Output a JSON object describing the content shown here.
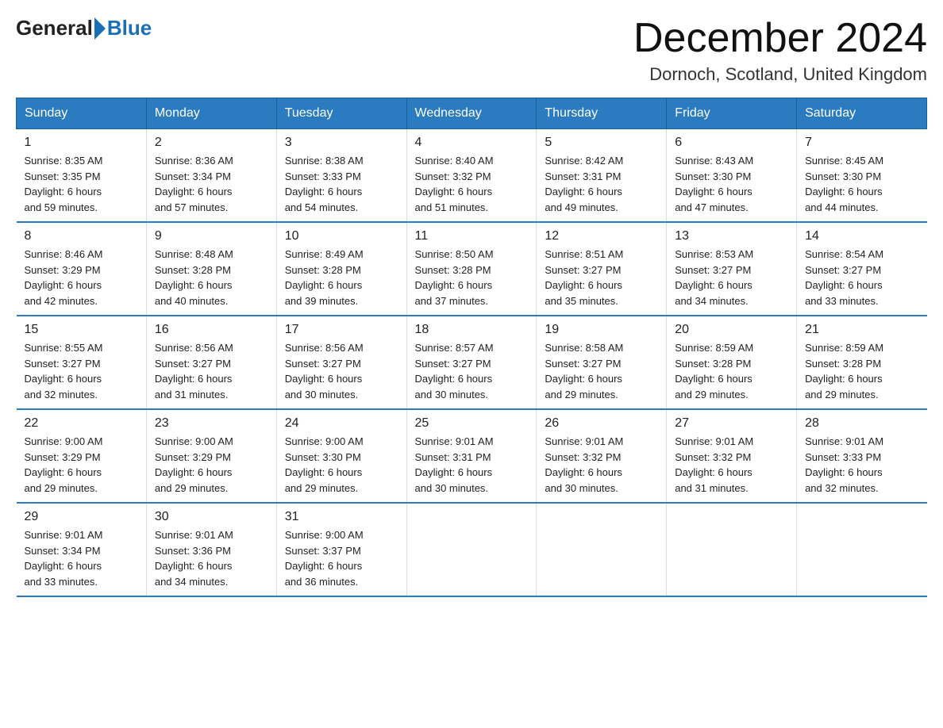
{
  "header": {
    "logo_general": "General",
    "logo_blue": "Blue",
    "title": "December 2024",
    "subtitle": "Dornoch, Scotland, United Kingdom"
  },
  "weekdays": [
    "Sunday",
    "Monday",
    "Tuesday",
    "Wednesday",
    "Thursday",
    "Friday",
    "Saturday"
  ],
  "weeks": [
    [
      {
        "day": "1",
        "sunrise": "8:35 AM",
        "sunset": "3:35 PM",
        "daylight": "6 hours and 59 minutes."
      },
      {
        "day": "2",
        "sunrise": "8:36 AM",
        "sunset": "3:34 PM",
        "daylight": "6 hours and 57 minutes."
      },
      {
        "day": "3",
        "sunrise": "8:38 AM",
        "sunset": "3:33 PM",
        "daylight": "6 hours and 54 minutes."
      },
      {
        "day": "4",
        "sunrise": "8:40 AM",
        "sunset": "3:32 PM",
        "daylight": "6 hours and 51 minutes."
      },
      {
        "day": "5",
        "sunrise": "8:42 AM",
        "sunset": "3:31 PM",
        "daylight": "6 hours and 49 minutes."
      },
      {
        "day": "6",
        "sunrise": "8:43 AM",
        "sunset": "3:30 PM",
        "daylight": "6 hours and 47 minutes."
      },
      {
        "day": "7",
        "sunrise": "8:45 AM",
        "sunset": "3:30 PM",
        "daylight": "6 hours and 44 minutes."
      }
    ],
    [
      {
        "day": "8",
        "sunrise": "8:46 AM",
        "sunset": "3:29 PM",
        "daylight": "6 hours and 42 minutes."
      },
      {
        "day": "9",
        "sunrise": "8:48 AM",
        "sunset": "3:28 PM",
        "daylight": "6 hours and 40 minutes."
      },
      {
        "day": "10",
        "sunrise": "8:49 AM",
        "sunset": "3:28 PM",
        "daylight": "6 hours and 39 minutes."
      },
      {
        "day": "11",
        "sunrise": "8:50 AM",
        "sunset": "3:28 PM",
        "daylight": "6 hours and 37 minutes."
      },
      {
        "day": "12",
        "sunrise": "8:51 AM",
        "sunset": "3:27 PM",
        "daylight": "6 hours and 35 minutes."
      },
      {
        "day": "13",
        "sunrise": "8:53 AM",
        "sunset": "3:27 PM",
        "daylight": "6 hours and 34 minutes."
      },
      {
        "day": "14",
        "sunrise": "8:54 AM",
        "sunset": "3:27 PM",
        "daylight": "6 hours and 33 minutes."
      }
    ],
    [
      {
        "day": "15",
        "sunrise": "8:55 AM",
        "sunset": "3:27 PM",
        "daylight": "6 hours and 32 minutes."
      },
      {
        "day": "16",
        "sunrise": "8:56 AM",
        "sunset": "3:27 PM",
        "daylight": "6 hours and 31 minutes."
      },
      {
        "day": "17",
        "sunrise": "8:56 AM",
        "sunset": "3:27 PM",
        "daylight": "6 hours and 30 minutes."
      },
      {
        "day": "18",
        "sunrise": "8:57 AM",
        "sunset": "3:27 PM",
        "daylight": "6 hours and 30 minutes."
      },
      {
        "day": "19",
        "sunrise": "8:58 AM",
        "sunset": "3:27 PM",
        "daylight": "6 hours and 29 minutes."
      },
      {
        "day": "20",
        "sunrise": "8:59 AM",
        "sunset": "3:28 PM",
        "daylight": "6 hours and 29 minutes."
      },
      {
        "day": "21",
        "sunrise": "8:59 AM",
        "sunset": "3:28 PM",
        "daylight": "6 hours and 29 minutes."
      }
    ],
    [
      {
        "day": "22",
        "sunrise": "9:00 AM",
        "sunset": "3:29 PM",
        "daylight": "6 hours and 29 minutes."
      },
      {
        "day": "23",
        "sunrise": "9:00 AM",
        "sunset": "3:29 PM",
        "daylight": "6 hours and 29 minutes."
      },
      {
        "day": "24",
        "sunrise": "9:00 AM",
        "sunset": "3:30 PM",
        "daylight": "6 hours and 29 minutes."
      },
      {
        "day": "25",
        "sunrise": "9:01 AM",
        "sunset": "3:31 PM",
        "daylight": "6 hours and 30 minutes."
      },
      {
        "day": "26",
        "sunrise": "9:01 AM",
        "sunset": "3:32 PM",
        "daylight": "6 hours and 30 minutes."
      },
      {
        "day": "27",
        "sunrise": "9:01 AM",
        "sunset": "3:32 PM",
        "daylight": "6 hours and 31 minutes."
      },
      {
        "day": "28",
        "sunrise": "9:01 AM",
        "sunset": "3:33 PM",
        "daylight": "6 hours and 32 minutes."
      }
    ],
    [
      {
        "day": "29",
        "sunrise": "9:01 AM",
        "sunset": "3:34 PM",
        "daylight": "6 hours and 33 minutes."
      },
      {
        "day": "30",
        "sunrise": "9:01 AM",
        "sunset": "3:36 PM",
        "daylight": "6 hours and 34 minutes."
      },
      {
        "day": "31",
        "sunrise": "9:00 AM",
        "sunset": "3:37 PM",
        "daylight": "6 hours and 36 minutes."
      },
      null,
      null,
      null,
      null
    ]
  ],
  "labels": {
    "sunrise": "Sunrise:",
    "sunset": "Sunset:",
    "daylight": "Daylight:"
  }
}
